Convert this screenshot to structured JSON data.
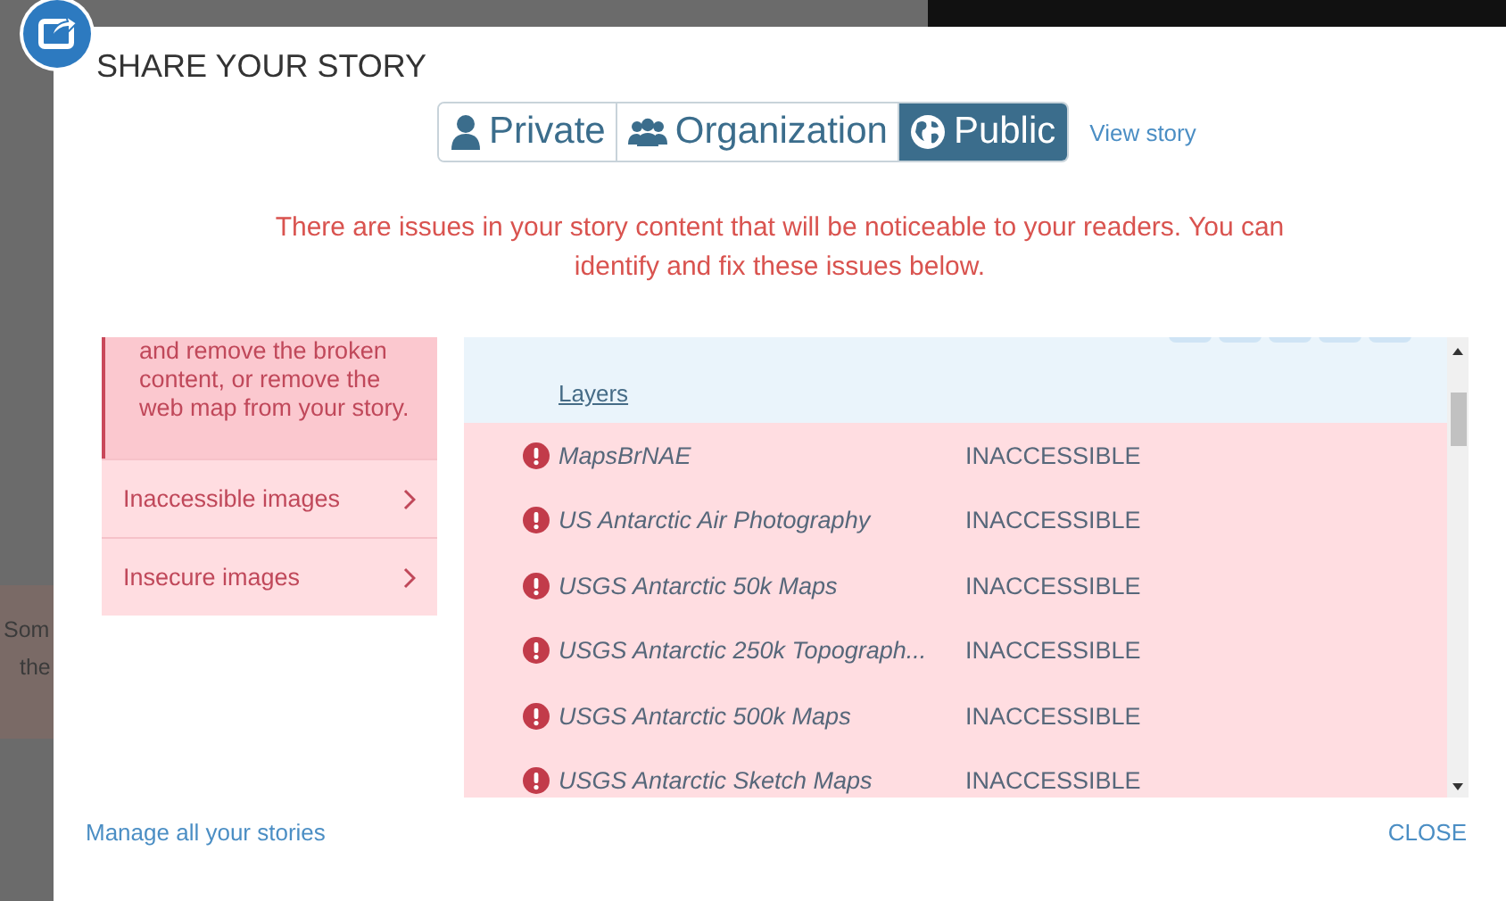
{
  "background_text": [
    "Som",
    "the"
  ],
  "dialog": {
    "title": "SHARE YOUR STORY"
  },
  "visibility": [
    {
      "label": "Private",
      "kind": "person",
      "selected": false
    },
    {
      "label": "Organization",
      "kind": "group",
      "selected": false
    },
    {
      "label": "Public",
      "kind": "globe",
      "selected": true
    }
  ],
  "view_story": "View story",
  "warning": "There are issues in your story content that will be noticeable to your readers. You can identify and fix these issues below.",
  "issue_message": "and remove the broken content, or remove the web map from your story.",
  "issue_categories": [
    {
      "label": "Inaccessible images",
      "selected": false
    },
    {
      "label": "Insecure images",
      "selected": false
    }
  ],
  "layers": {
    "header": "Layers",
    "rows": [
      {
        "name": "MapsBrNAE",
        "status": "INACCESSIBLE"
      },
      {
        "name": "US Antarctic Air Photography",
        "status": "INACCESSIBLE"
      },
      {
        "name": "USGS Antarctic 50k Maps",
        "status": "INACCESSIBLE"
      },
      {
        "name": "USGS Antarctic 250k Topograph...",
        "status": "INACCESSIBLE"
      },
      {
        "name": "USGS Antarctic 500k Maps",
        "status": "INACCESSIBLE"
      },
      {
        "name": "USGS Antarctic Sketch Maps",
        "status": "INACCESSIBLE"
      }
    ]
  },
  "footer": {
    "manage_link": "Manage all your stories",
    "close": "CLOSE"
  }
}
